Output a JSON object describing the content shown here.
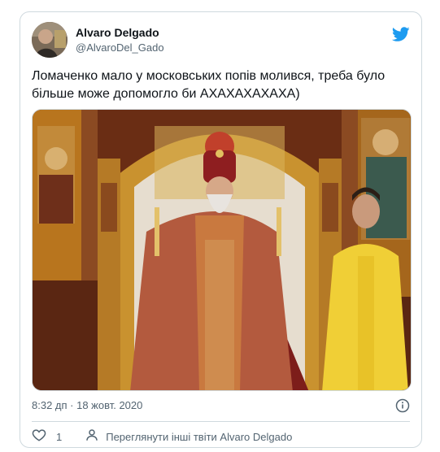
{
  "author": {
    "display_name": "Alvaro Delgado",
    "handle": "@AlvaroDel_Gado"
  },
  "tweet": {
    "text": "Ломаченко мало у московських попів молився, треба було більше може допомогло би АХАХАХАХАХА)",
    "timestamp": "8:32 дп · 18 жовт. 2020"
  },
  "actions": {
    "like_count": "1",
    "more_tweets_label": "Переглянути інші твіти Alvaro Delgado"
  },
  "colors": {
    "twitter_blue": "#1d9bf0",
    "muted_text": "#536471",
    "border": "#cfd9de"
  },
  "icons": {
    "brand": "twitter-bird-icon",
    "info": "info-icon",
    "like": "heart-icon",
    "profile": "user-icon"
  }
}
